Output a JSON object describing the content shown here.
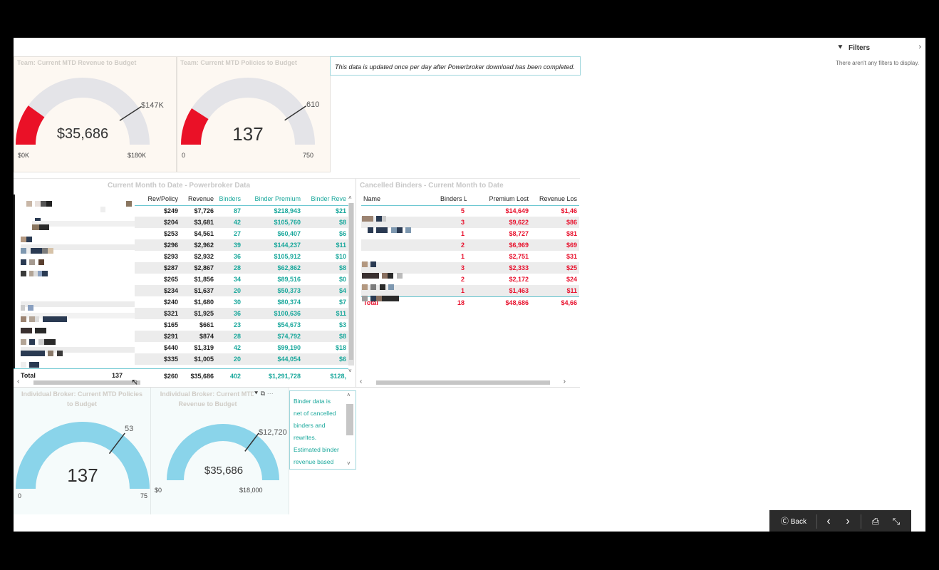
{
  "filters": {
    "label": "Filters",
    "empty_text": "There aren't any filters to display."
  },
  "note_top": "This data is updated once per day after Powerbroker download has been completed.",
  "gauges": {
    "team_revenue": {
      "title": "Team: Current MTD Revenue to Budget",
      "value_label": "$35,686",
      "target_label": "$147K",
      "min_label": "$0K",
      "max_label": "$180K",
      "value": 35686,
      "target": 147000,
      "max": 180000,
      "color": "#ea1127"
    },
    "team_policies": {
      "title": "Team: Current MTD Policies to Budget",
      "value_label": "137",
      "target_label": "610",
      "min_label": "0",
      "max_label": "750",
      "value": 137,
      "target": 610,
      "max": 750,
      "color": "#ea1127"
    },
    "broker_policies": {
      "title": "Individual Broker: Current MTD Policies to Budget",
      "value_label": "137",
      "target_label": "53",
      "min_label": "0",
      "max_label": "75",
      "value": 137,
      "target": 53,
      "max": 75,
      "color": "#8ad4ea"
    },
    "broker_revenue": {
      "title": "Individual Broker: Current MTD Revenue to Budget",
      "value_label": "$35,686",
      "target_label": "$12,720",
      "min_label": "$0",
      "max_label": "$18,000",
      "value": 35686,
      "target": 12720,
      "max": 18000,
      "color": "#8ad4ea"
    }
  },
  "powerbroker_table": {
    "title": "Current Month to Date - Powerbroker Data",
    "columns": [
      "Rev/Policy",
      "Revenue",
      "Binders",
      "Binder Premium",
      "Binder Reve"
    ],
    "rows": [
      [
        "$249",
        "$7,726",
        "87",
        "$218,943",
        "$21"
      ],
      [
        "$204",
        "$3,681",
        "42",
        "$105,760",
        "$8"
      ],
      [
        "$253",
        "$4,561",
        "27",
        "$60,407",
        "$6"
      ],
      [
        "$296",
        "$2,962",
        "39",
        "$144,237",
        "$11"
      ],
      [
        "$293",
        "$2,932",
        "36",
        "$105,912",
        "$10"
      ],
      [
        "$287",
        "$2,867",
        "28",
        "$62,862",
        "$8"
      ],
      [
        "$265",
        "$1,856",
        "34",
        "$89,516",
        "$0"
      ],
      [
        "$234",
        "$1,637",
        "20",
        "$50,373",
        "$4"
      ],
      [
        "$240",
        "$1,680",
        "30",
        "$80,374",
        "$7"
      ],
      [
        "$321",
        "$1,925",
        "36",
        "$100,636",
        "$11"
      ],
      [
        "$165",
        "$661",
        "23",
        "$54,673",
        "$3"
      ],
      [
        "$291",
        "$874",
        "28",
        "$74,792",
        "$8"
      ],
      [
        "$440",
        "$1,319",
        "42",
        "$99,190",
        "$18"
      ],
      [
        "$335",
        "$1,005",
        "20",
        "$44,054",
        "$6"
      ]
    ],
    "total": {
      "label": "Total",
      "count": "137",
      "values": [
        "$260",
        "$35,686",
        "402",
        "$1,291,728",
        "$128,"
      ]
    }
  },
  "cancelled_table": {
    "title": "Cancelled Binders - Current Month to Date",
    "columns": [
      "Name",
      "Binders Lost",
      "Premium Lost",
      "Revenue Los"
    ],
    "rows": [
      [
        "5",
        "$14,649",
        "$1,46"
      ],
      [
        "3",
        "$9,622",
        "$86"
      ],
      [
        "1",
        "$8,727",
        "$81"
      ],
      [
        "2",
        "$6,969",
        "$69"
      ],
      [
        "1",
        "$2,751",
        "$31"
      ],
      [
        "3",
        "$2,333",
        "$25"
      ],
      [
        "2",
        "$2,172",
        "$24"
      ],
      [
        "1",
        "$1,463",
        "$11"
      ]
    ],
    "total": {
      "label": "Total",
      "values": [
        "18",
        "$48,686",
        "$4,66"
      ]
    }
  },
  "note_bottom": {
    "lines": [
      "Binder data is",
      "net of cancelled",
      "binders and",
      "rewrites.",
      "Estimated binder",
      "revenue based"
    ]
  },
  "nav": {
    "back_label": "Back"
  }
}
